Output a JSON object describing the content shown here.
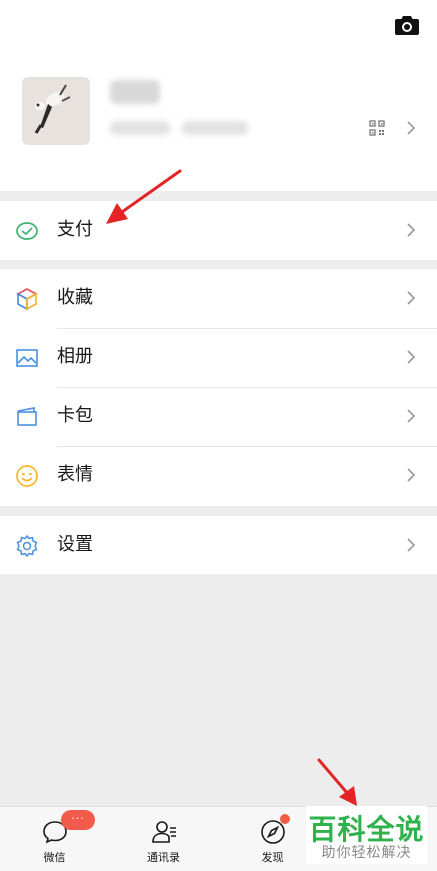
{
  "icons": {
    "camera": "camera-icon",
    "qr": "qr-code-icon",
    "chevron": "chevron-right-icon",
    "pay": "pay-check-icon",
    "favorites": "cube-icon",
    "album": "image-icon",
    "card": "wallet-icon",
    "stickers": "smiley-icon",
    "settings": "gear-icon"
  },
  "menu": {
    "pay": "支付",
    "favorites": "收藏",
    "album": "相册",
    "card": "卡包",
    "stickers": "表情",
    "settings": "设置"
  },
  "tabbar": {
    "chats": "微信",
    "contacts": "通讯录",
    "discover": "发现",
    "chats_badge": "···"
  },
  "watermark": {
    "title": "百科全说",
    "subtitle": "助你轻松解决"
  },
  "colors": {
    "pay_green": "#3cb371",
    "badge_red": "#f25b4a",
    "annotation_red": "#e42424",
    "watermark_green": "#2fb14c"
  }
}
